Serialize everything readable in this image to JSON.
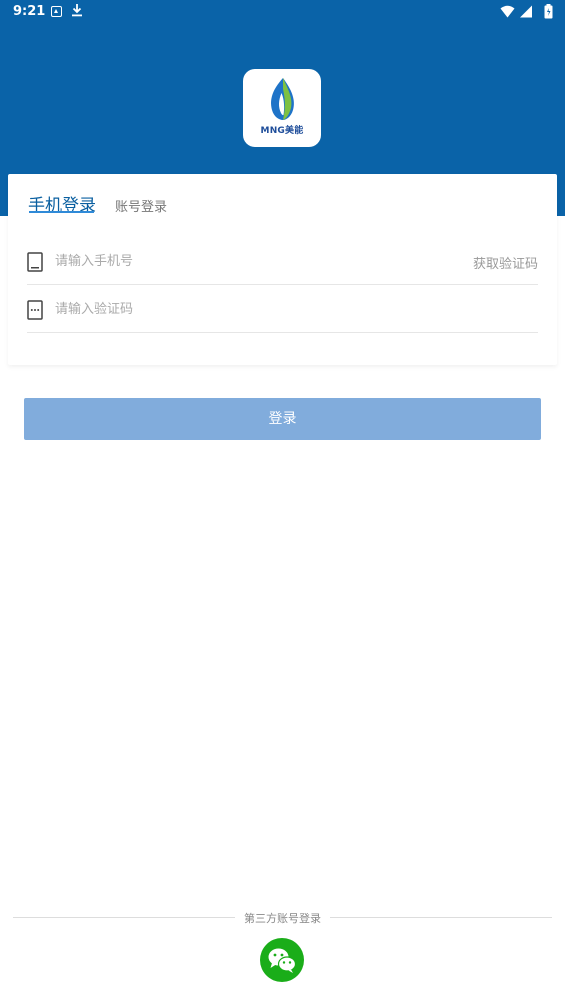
{
  "status_bar": {
    "time": "9:21",
    "icons": [
      "notification-a-icon",
      "download-icon",
      "wifi-icon",
      "signal-icon",
      "battery-icon"
    ]
  },
  "logo": {
    "text": "MNG美能"
  },
  "login_tabs": {
    "phone": "手机登录",
    "account": "账号登录"
  },
  "phone_field": {
    "placeholder": "请输入手机号",
    "value": ""
  },
  "get_code_label": "获取验证码",
  "code_field": {
    "placeholder": "请输入验证码",
    "value": ""
  },
  "login_button": "登录",
  "third_party": {
    "label": "第三方账号登录",
    "providers": [
      "wechat-icon"
    ]
  },
  "colors": {
    "header_blue": "#0a63a8",
    "tab_active": "#0a5fa0",
    "login_button": "#81acdc",
    "wechat_green": "#1aad19"
  }
}
